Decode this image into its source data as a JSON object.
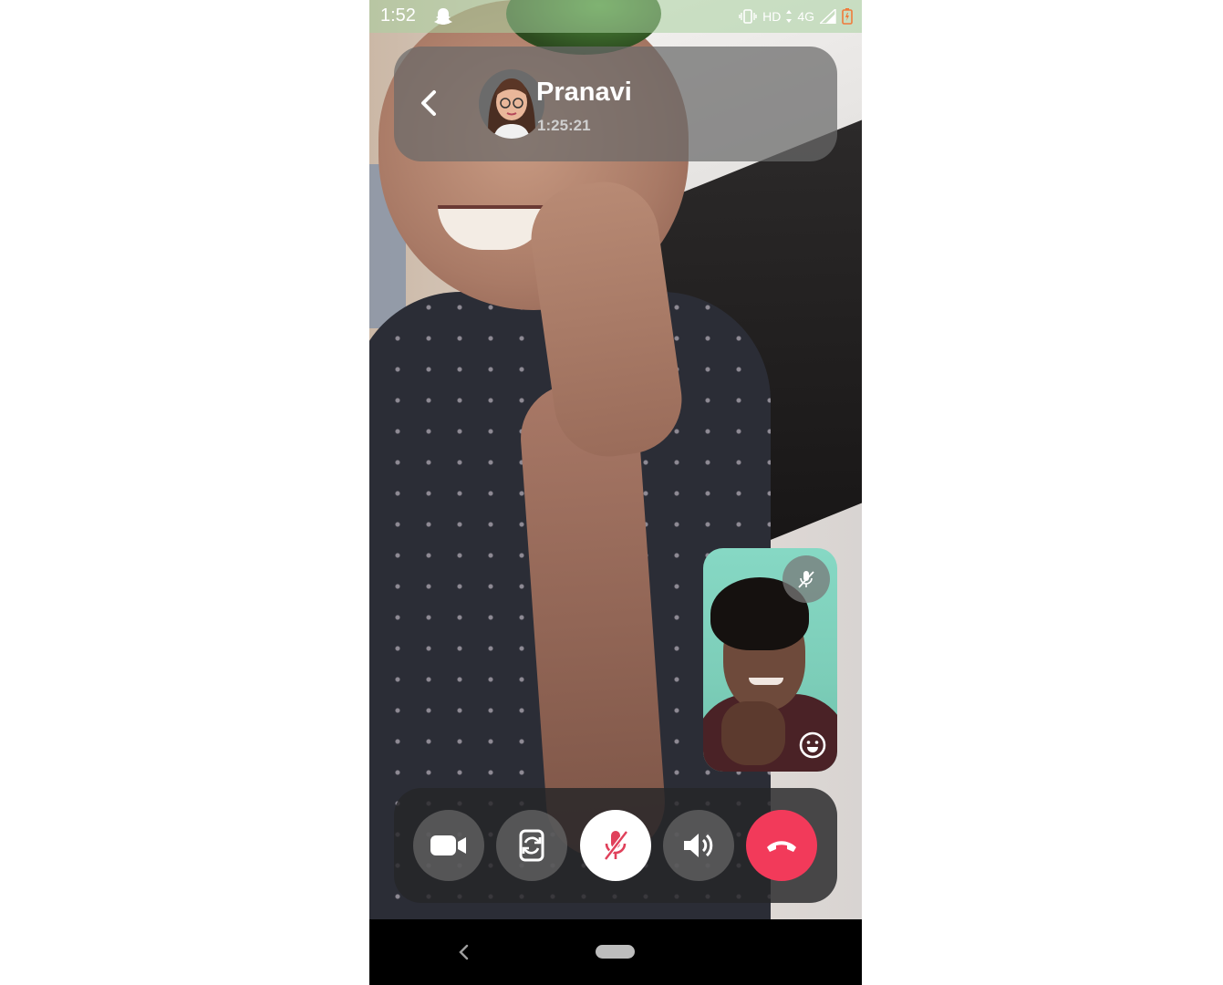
{
  "status_bar": {
    "time": "1:52",
    "network_hd": "HD",
    "network_type": "4G"
  },
  "call_header": {
    "caller_name": "Pranavi",
    "duration": "1:25:21"
  },
  "controls": {
    "items": [
      {
        "name": "video-camera",
        "icon": "video-camera-icon",
        "state": "on"
      },
      {
        "name": "flip-camera",
        "icon": "flip-camera-icon",
        "state": "idle"
      },
      {
        "name": "mute",
        "icon": "mic-off-icon",
        "state": "muted"
      },
      {
        "name": "speaker",
        "icon": "speaker-icon",
        "state": "on"
      },
      {
        "name": "end-call",
        "icon": "hang-up-icon",
        "state": "active"
      }
    ]
  },
  "colors": {
    "end_call": "#f23a5a",
    "muted_icon": "#e0405a",
    "header_bg": "#696969"
  }
}
